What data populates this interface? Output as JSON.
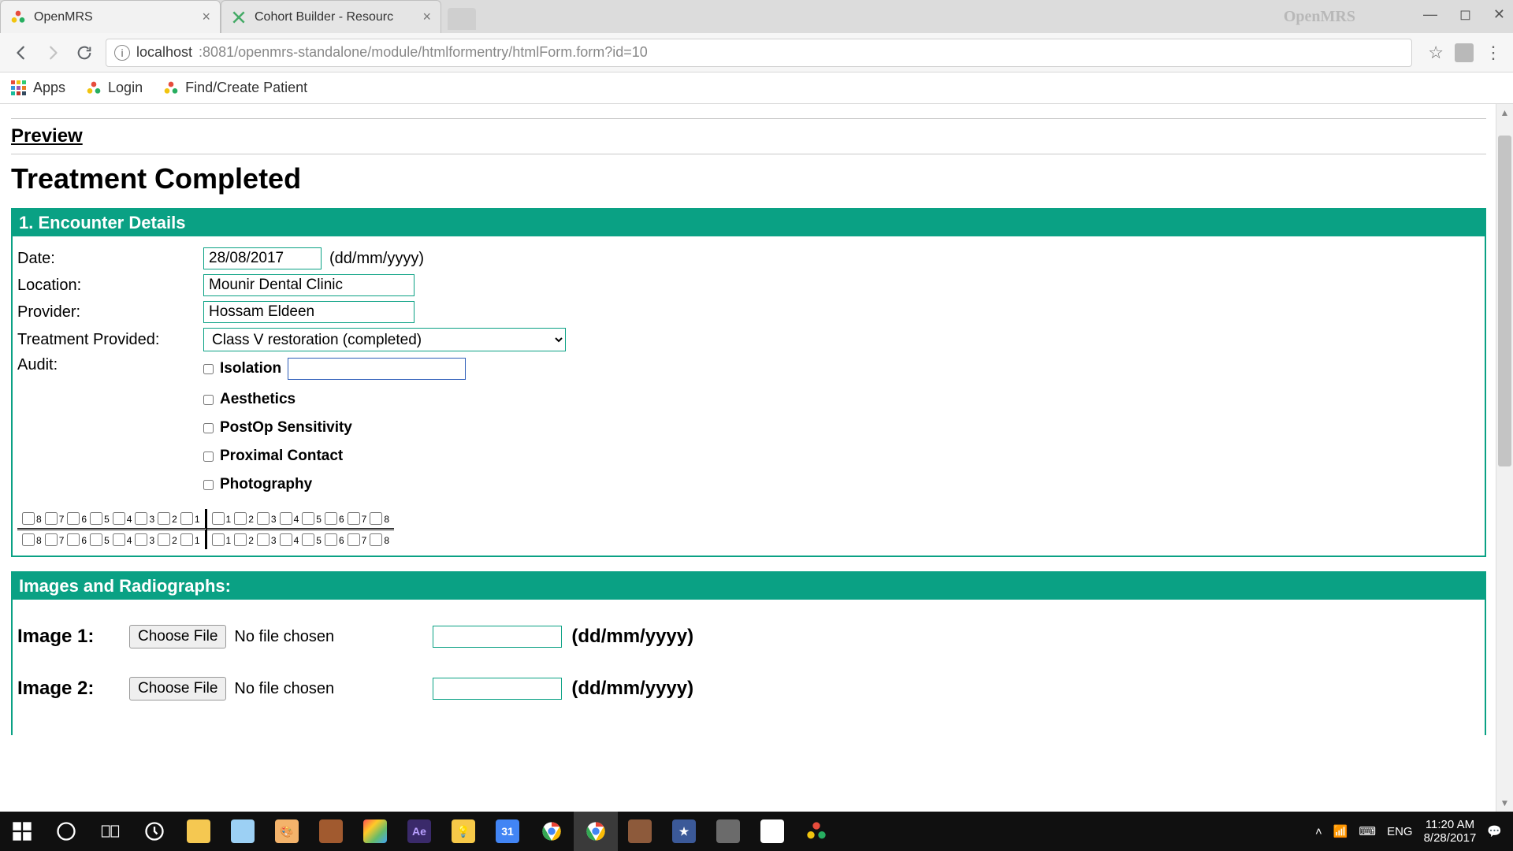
{
  "chrome": {
    "tabs": [
      {
        "title": "OpenMRS",
        "active": true
      },
      {
        "title": "Cohort Builder - Resourc",
        "active": false
      }
    ],
    "brand_right": "OpenMRS",
    "url_host": "localhost",
    "url_rest": ":8081/openmrs-standalone/module/htmlformentry/htmlForm.form?id=10"
  },
  "bookmarks": {
    "apps": "Apps",
    "login": "Login",
    "find": "Find/Create Patient"
  },
  "page": {
    "preview": "Preview",
    "title": "Treatment Completed",
    "section1": {
      "title": "1. Encounter Details",
      "date_label": "Date:",
      "date_value": "28/08/2017",
      "date_hint": "(dd/mm/yyyy)",
      "location_label": "Location:",
      "location_value": "Mounir Dental Clinic",
      "provider_label": "Provider:",
      "provider_value": "Hossam Eldeen",
      "treatment_label": "Treatment Provided:",
      "treatment_value": "Class V restoration (completed)",
      "audit_label": "Audit:",
      "audit_items": [
        "Isolation",
        "Aesthetics",
        "PostOp Sensitivity",
        "Proximal Contact",
        "Photography"
      ],
      "tooth_numbers_left": [
        "8",
        "7",
        "6",
        "5",
        "4",
        "3",
        "2",
        "1"
      ],
      "tooth_numbers_right": [
        "1",
        "2",
        "3",
        "4",
        "5",
        "6",
        "7",
        "8"
      ]
    },
    "section2": {
      "title": "Images and Radiographs:",
      "rows": [
        {
          "label": "Image 1:",
          "button": "Choose File",
          "nofile": "No file chosen",
          "date_hint": "(dd/mm/yyyy)"
        },
        {
          "label": "Image 2:",
          "button": "Choose File",
          "nofile": "No file chosen",
          "date_hint": "(dd/mm/yyyy)"
        }
      ]
    }
  },
  "taskbar": {
    "lang": "ENG",
    "time": "11:20 AM",
    "date": "8/28/2017"
  }
}
